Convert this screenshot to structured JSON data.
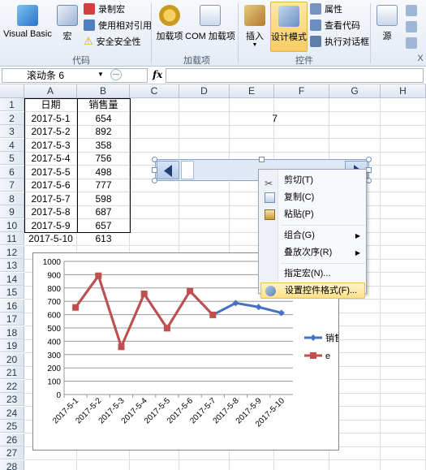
{
  "ribbon": {
    "vb_label": "Visual Basic",
    "macro_label": "宏",
    "record_macro": "录制宏",
    "relative_ref": "使用相对引用",
    "macro_security": "安全安全性",
    "group_code": "代码",
    "addins_label": "加载项",
    "com_addins_label": "COM 加载项",
    "group_addins": "加载项",
    "insert_label": "插入",
    "design_mode_label": "设计模式",
    "properties_label": "属性",
    "view_code_label": "查看代码",
    "run_dialog_label": "执行对话框",
    "group_controls": "控件",
    "source_label": "源",
    "x_label": "X"
  },
  "formula_bar": {
    "name_box": "滚动条 6",
    "fx": "fx",
    "value": ""
  },
  "columns": [
    "A",
    "B",
    "C",
    "D",
    "E",
    "F",
    "G",
    "H"
  ],
  "rows": [
    "1",
    "2",
    "3",
    "4",
    "5",
    "6",
    "7",
    "8",
    "9",
    "10",
    "11",
    "12",
    "13",
    "14",
    "15",
    "16",
    "17",
    "18",
    "19",
    "20",
    "21",
    "22",
    "23",
    "24",
    "25",
    "26",
    "27",
    "28"
  ],
  "table": {
    "header_date": "日期",
    "header_sales": "销售量",
    "data": [
      {
        "date": "2017-5-1",
        "sales": "654"
      },
      {
        "date": "2017-5-2",
        "sales": "892"
      },
      {
        "date": "2017-5-3",
        "sales": "358"
      },
      {
        "date": "2017-5-4",
        "sales": "756"
      },
      {
        "date": "2017-5-5",
        "sales": "498"
      },
      {
        "date": "2017-5-6",
        "sales": "777"
      },
      {
        "date": "2017-5-7",
        "sales": "598"
      },
      {
        "date": "2017-5-8",
        "sales": "687"
      },
      {
        "date": "2017-5-9",
        "sales": "657"
      },
      {
        "date": "2017-5-10",
        "sales": "613"
      }
    ]
  },
  "cell_e2": "7",
  "context_menu": {
    "cut": "剪切(T)",
    "copy": "复制(C)",
    "paste": "粘贴(P)",
    "group": "组合(G)",
    "order": "叠放次序(R)",
    "assign_macro": "指定宏(N)...",
    "format_control": "设置控件格式(F)..."
  },
  "chart_data": {
    "type": "line",
    "categories": [
      "2017-5-1",
      "2017-5-2",
      "2017-5-3",
      "2017-5-4",
      "2017-5-5",
      "2017-5-6",
      "2017-5-7",
      "2017-5-8",
      "2017-5-9",
      "2017-5-10"
    ],
    "series": [
      {
        "name": "销售量",
        "color": "#4472c4",
        "values": [
          654,
          892,
          358,
          756,
          498,
          777,
          598,
          687,
          657,
          613
        ]
      },
      {
        "name": "e",
        "color": "#c0504d",
        "values": [
          654,
          892,
          358,
          756,
          498,
          777,
          598,
          null,
          null,
          null
        ]
      }
    ],
    "yticks": [
      "0",
      "100",
      "200",
      "300",
      "400",
      "500",
      "600",
      "700",
      "800",
      "900",
      "1000"
    ],
    "ylim": [
      0,
      1000
    ],
    "grid": true,
    "legend": "right"
  }
}
